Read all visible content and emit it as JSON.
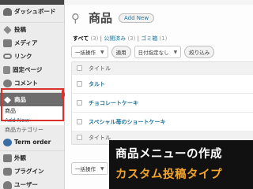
{
  "sidebar": {
    "items": [
      {
        "label": "ダッシュボード",
        "icon": "dashboard-icon"
      },
      {
        "label": "投稿",
        "icon": "pushpin-icon"
      },
      {
        "label": "メディア",
        "icon": "media-icon"
      },
      {
        "label": "リンク",
        "icon": "link-icon"
      },
      {
        "label": "固定ページ",
        "icon": "page-icon"
      },
      {
        "label": "コメント",
        "icon": "comment-icon"
      }
    ],
    "active_item": {
      "label": "商品",
      "icon": "pushpin-icon"
    },
    "submenu": [
      "商品",
      "Add New"
    ],
    "sub_category": "商品カテゴリー",
    "items_after": [
      {
        "label": "Term order",
        "icon": "term-order-icon"
      },
      {
        "label": "外観",
        "icon": "appearance-icon"
      },
      {
        "label": "プラグイン",
        "icon": "plugin-icon"
      },
      {
        "label": "ユーザー",
        "icon": "users-icon"
      }
    ]
  },
  "header": {
    "title": "商品",
    "add_new_label": "Add New"
  },
  "filters": {
    "all_label": "すべて",
    "all_count": "(3)",
    "published_label": "公開済み",
    "published_count": "(3)",
    "trash_label": "ゴミ箱",
    "trash_count": "(1)"
  },
  "actions": {
    "bulk_select": "一括操作",
    "apply_label": "適用",
    "date_select": "日付指定なし",
    "filter_label": "絞り込み"
  },
  "table": {
    "column_header": "タイトル",
    "rows": [
      "タルト",
      "チョコレートケーキ",
      "スペシャル苺のショートケーキ",
      "タイトル"
    ]
  },
  "bottom_actions": {
    "bulk_select": "一括操作"
  },
  "caption": {
    "line1": "商品メニューの作成",
    "line2": "カスタム投稿タイプ"
  },
  "colors": {
    "highlight": "#d9312b",
    "accent_link": "#21759b",
    "caption_orange": "#f3a42a",
    "caption_bg": "#111111"
  }
}
